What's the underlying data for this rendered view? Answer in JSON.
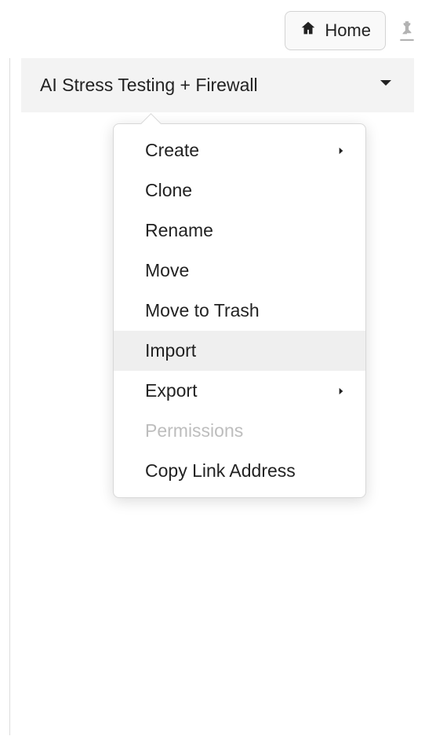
{
  "topbar": {
    "home_label": "Home"
  },
  "collection": {
    "title": "AI Stress Testing + Firewall"
  },
  "contextMenu": {
    "items": [
      {
        "label": "Create",
        "hasSubmenu": true,
        "disabled": false,
        "hovered": false
      },
      {
        "label": "Clone",
        "hasSubmenu": false,
        "disabled": false,
        "hovered": false
      },
      {
        "label": "Rename",
        "hasSubmenu": false,
        "disabled": false,
        "hovered": false
      },
      {
        "label": "Move",
        "hasSubmenu": false,
        "disabled": false,
        "hovered": false
      },
      {
        "label": "Move to Trash",
        "hasSubmenu": false,
        "disabled": false,
        "hovered": false
      },
      {
        "label": "Import",
        "hasSubmenu": false,
        "disabled": false,
        "hovered": true
      },
      {
        "label": "Export",
        "hasSubmenu": true,
        "disabled": false,
        "hovered": false
      },
      {
        "label": "Permissions",
        "hasSubmenu": false,
        "disabled": true,
        "hovered": false
      },
      {
        "label": "Copy Link Address",
        "hasSubmenu": false,
        "disabled": false,
        "hovered": false
      }
    ]
  }
}
